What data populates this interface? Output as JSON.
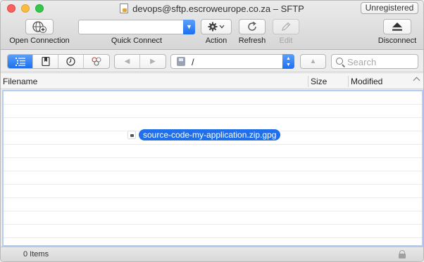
{
  "window": {
    "title": "devops@sftp.escroweurope.co.za – SFTP",
    "badge": "Unregistered"
  },
  "toolbar": {
    "open_connection": "Open Connection",
    "quick_connect": "Quick Connect",
    "quick_connect_value": "",
    "action": "Action",
    "refresh": "Refresh",
    "edit": "Edit",
    "disconnect": "Disconnect"
  },
  "nav": {
    "path": "/",
    "search_placeholder": "Search"
  },
  "table": {
    "columns": [
      "Filename",
      "Size",
      "Modified"
    ],
    "files": [
      {
        "name": "source-code-my-application.zip.gpg",
        "selected": true
      }
    ]
  },
  "status": {
    "items_text": "0 Items"
  },
  "colors": {
    "accent": "#1f6feb",
    "selection_border": "#b4cdf1"
  }
}
